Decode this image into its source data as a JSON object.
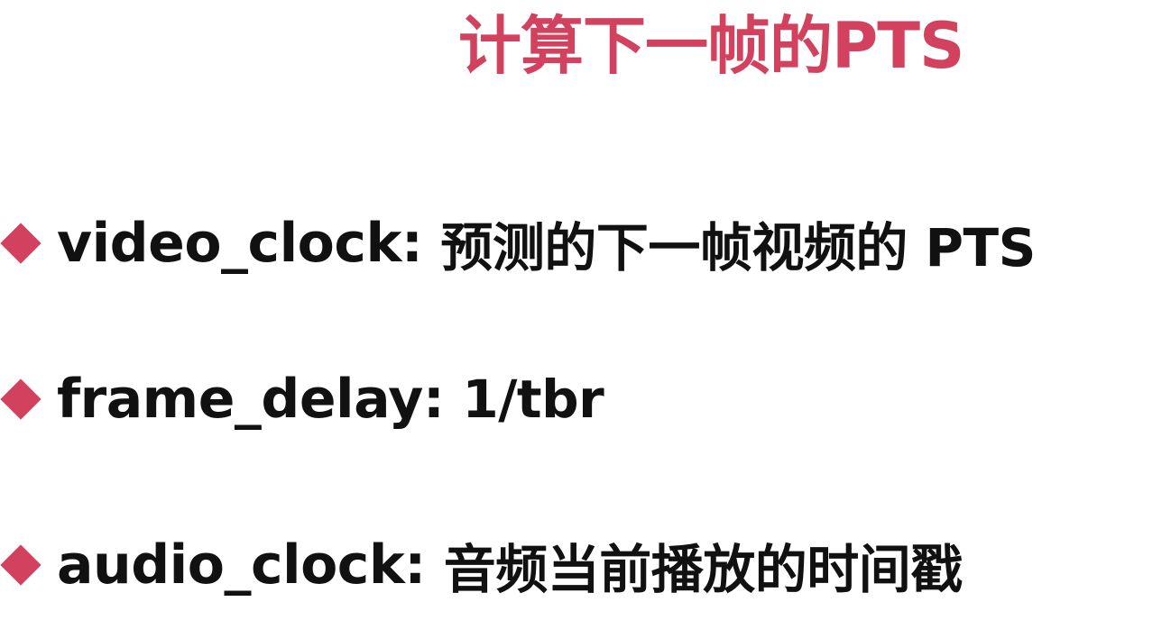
{
  "title": "计算下一帧的PTS",
  "colors": {
    "accent": "#d2425e",
    "text": "#111111",
    "background": "#ffffff"
  },
  "bullets": [
    {
      "icon": "diamond-bullet-icon",
      "term": "video_clock:",
      "description": "预测的下一帧视频的 PTS"
    },
    {
      "icon": "diamond-bullet-icon",
      "term": "frame_delay:",
      "description": "1/tbr"
    },
    {
      "icon": "diamond-bullet-icon",
      "term": "audio_clock:",
      "description": "音频当前播放的时间戳"
    }
  ]
}
